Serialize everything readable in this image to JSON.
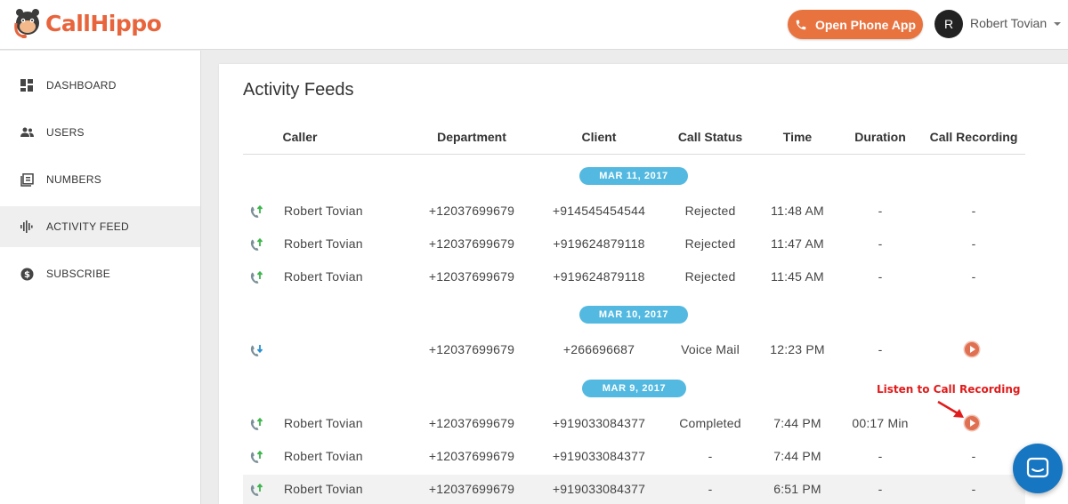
{
  "header": {
    "logo_text": "CallHippo",
    "open_phone_label": "Open Phone App",
    "avatar_initial": "R",
    "user_name": "Robert Tovian"
  },
  "sidebar": {
    "items": [
      {
        "label": "DASHBOARD",
        "icon": "dashboard-icon",
        "active": false
      },
      {
        "label": "USERS",
        "icon": "users-icon",
        "active": false
      },
      {
        "label": "NUMBERS",
        "icon": "numbers-icon",
        "active": false
      },
      {
        "label": "ACTIVITY FEED",
        "icon": "activity-feed-icon",
        "active": true
      },
      {
        "label": "SUBSCRIBE",
        "icon": "subscribe-icon",
        "active": false
      }
    ]
  },
  "main": {
    "title": "Activity Feeds",
    "columns": [
      "Caller",
      "Department",
      "Client",
      "Call Status",
      "Time",
      "Duration",
      "Call Recording"
    ],
    "groups": [
      {
        "date": "MAR 11, 2017",
        "rows": [
          {
            "direction": "outgoing",
            "caller": "Robert Tovian",
            "department": "+12037699679",
            "client": "+914545454544",
            "status": "Rejected",
            "time": "11:48 AM",
            "duration": "-",
            "recording": "-"
          },
          {
            "direction": "outgoing",
            "caller": "Robert Tovian",
            "department": "+12037699679",
            "client": "+919624879118",
            "status": "Rejected",
            "time": "11:47 AM",
            "duration": "-",
            "recording": "-"
          },
          {
            "direction": "outgoing",
            "caller": "Robert Tovian",
            "department": "+12037699679",
            "client": "+919624879118",
            "status": "Rejected",
            "time": "11:45 AM",
            "duration": "-",
            "recording": "-"
          }
        ]
      },
      {
        "date": "MAR 10, 2017",
        "rows": [
          {
            "direction": "incoming",
            "caller": "",
            "department": "+12037699679",
            "client": "+266696687",
            "status": "Voice Mail",
            "time": "12:23 PM",
            "duration": "-",
            "recording": "play"
          }
        ]
      },
      {
        "date": "MAR 9, 2017",
        "rows": [
          {
            "direction": "outgoing",
            "caller": "Robert Tovian",
            "department": "+12037699679",
            "client": "+919033084377",
            "status": "Completed",
            "time": "7:44 PM",
            "duration": "00:17 Min",
            "recording": "play"
          },
          {
            "direction": "outgoing",
            "caller": "Robert Tovian",
            "department": "+12037699679",
            "client": "+919033084377",
            "status": "-",
            "time": "7:44 PM",
            "duration": "-",
            "recording": "-"
          },
          {
            "direction": "outgoing",
            "caller": "Robert Tovian",
            "department": "+12037699679",
            "client": "+919033084377",
            "status": "-",
            "time": "6:51 PM",
            "duration": "-",
            "recording": "-"
          }
        ]
      }
    ]
  },
  "annotation": "Listen to Call Recording",
  "colors": {
    "brand": "#e8643c",
    "date_pill": "#53b9e0",
    "play": "#e07052",
    "chat": "#1676c2",
    "annotation": "#e01b1b"
  }
}
